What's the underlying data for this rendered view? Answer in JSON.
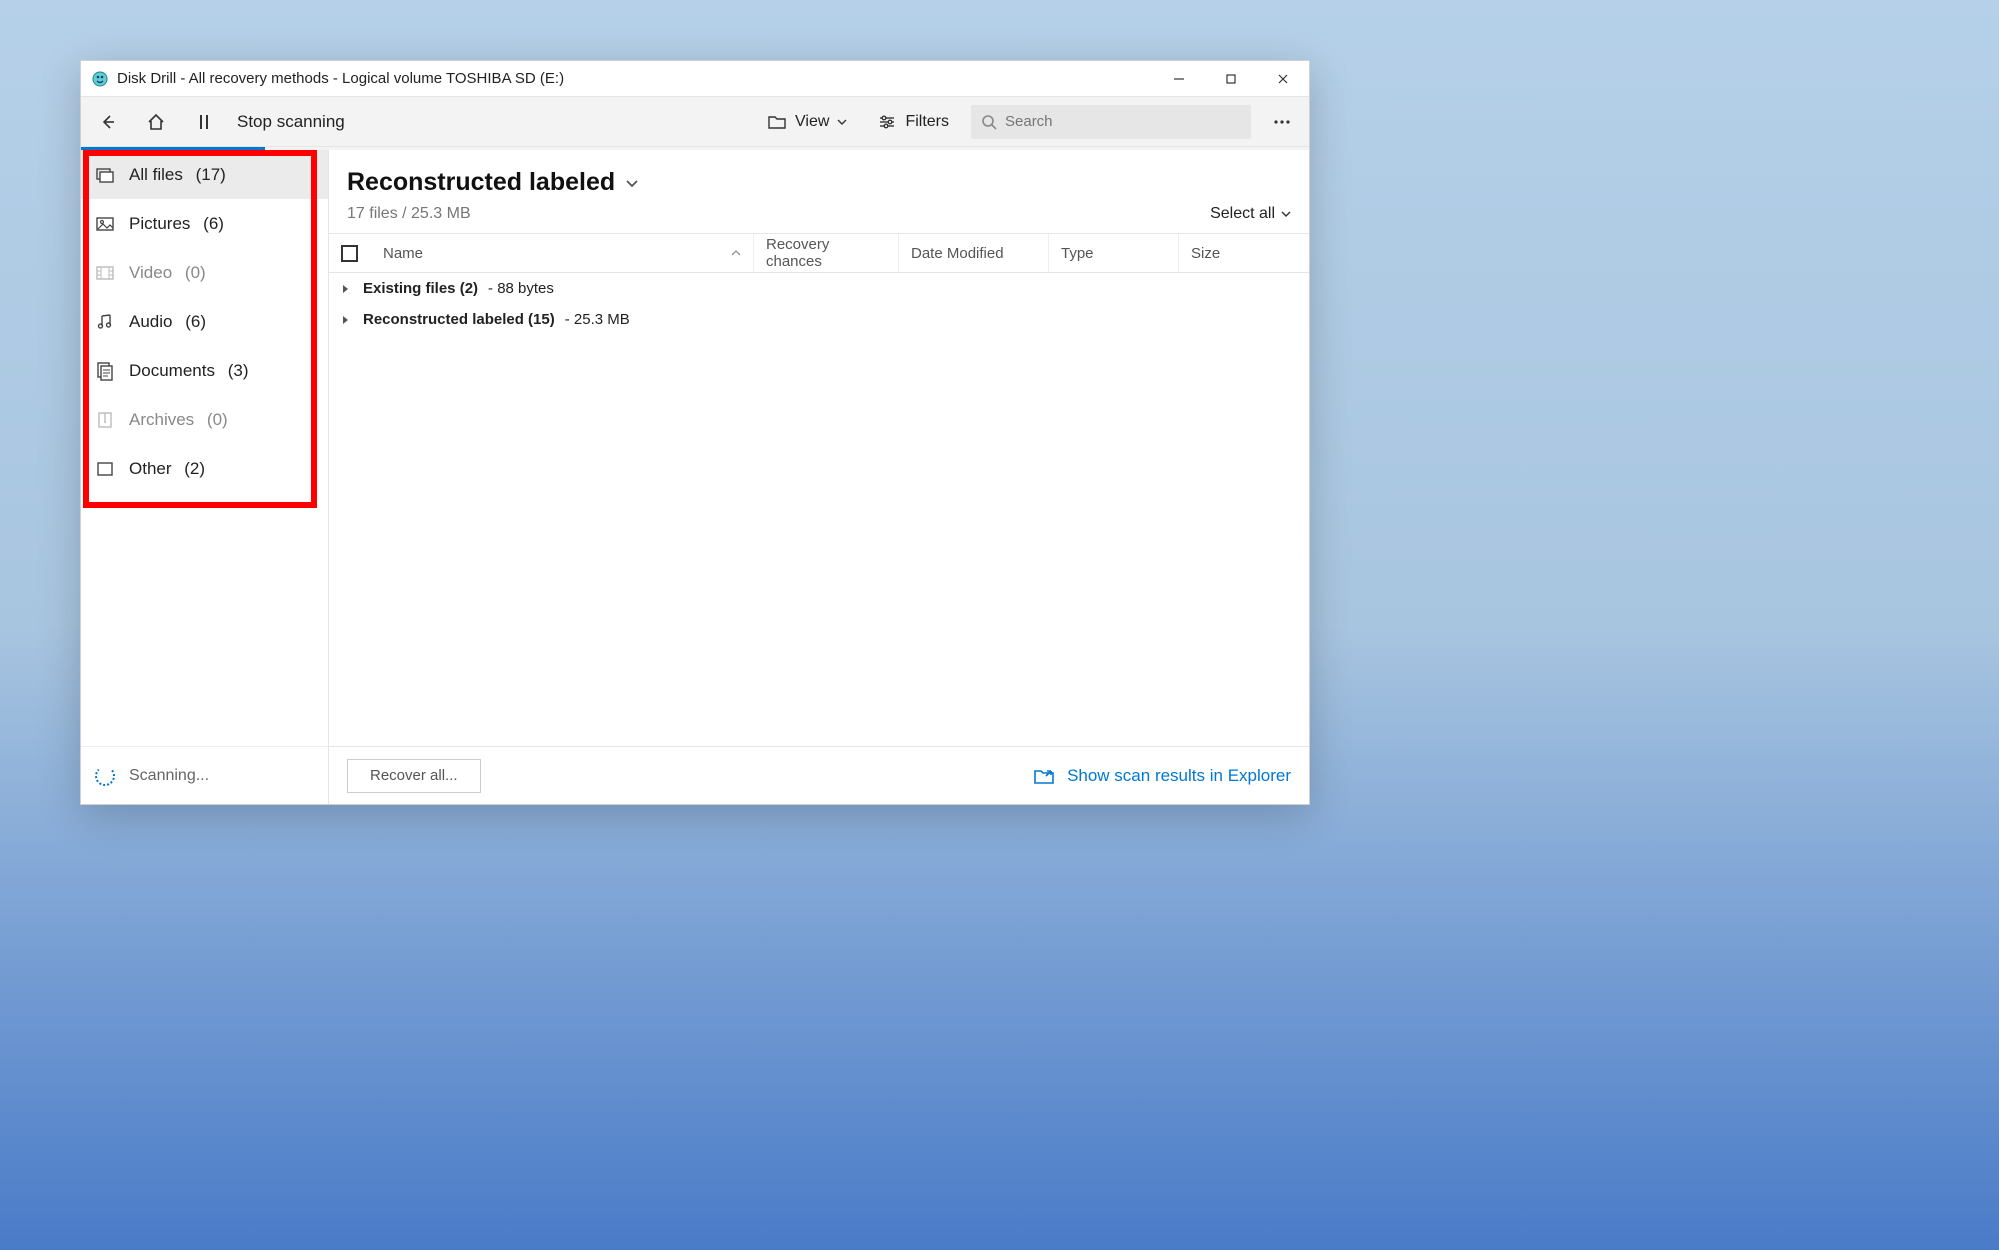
{
  "window": {
    "title": "Disk Drill - All recovery methods - Logical volume TOSHIBA SD (E:)"
  },
  "toolbar": {
    "stop_label": "Stop scanning",
    "view_label": "View",
    "filters_label": "Filters",
    "search_placeholder": "Search"
  },
  "sidebar": {
    "items": [
      {
        "label": "All files",
        "count": "(17)"
      },
      {
        "label": "Pictures",
        "count": "(6)"
      },
      {
        "label": "Video",
        "count": "(0)"
      },
      {
        "label": "Audio",
        "count": "(6)"
      },
      {
        "label": "Documents",
        "count": "(3)"
      },
      {
        "label": "Archives",
        "count": "(0)"
      },
      {
        "label": "Other",
        "count": "(2)"
      }
    ],
    "footer": "Scanning..."
  },
  "main": {
    "title": "Reconstructed labeled",
    "subtitle": "17 files / 25.3 MB",
    "select_all": "Select all",
    "columns": {
      "name": "Name",
      "recovery": "Recovery chances",
      "date": "Date Modified",
      "type": "Type",
      "size": "Size"
    },
    "groups": [
      {
        "name": "Existing files (2)",
        "detail": "- 88 bytes"
      },
      {
        "name": "Reconstructed labeled (15)",
        "detail": "- 25.3 MB"
      }
    ]
  },
  "footer": {
    "recover": "Recover all...",
    "explorer": "Show scan results in Explorer"
  }
}
